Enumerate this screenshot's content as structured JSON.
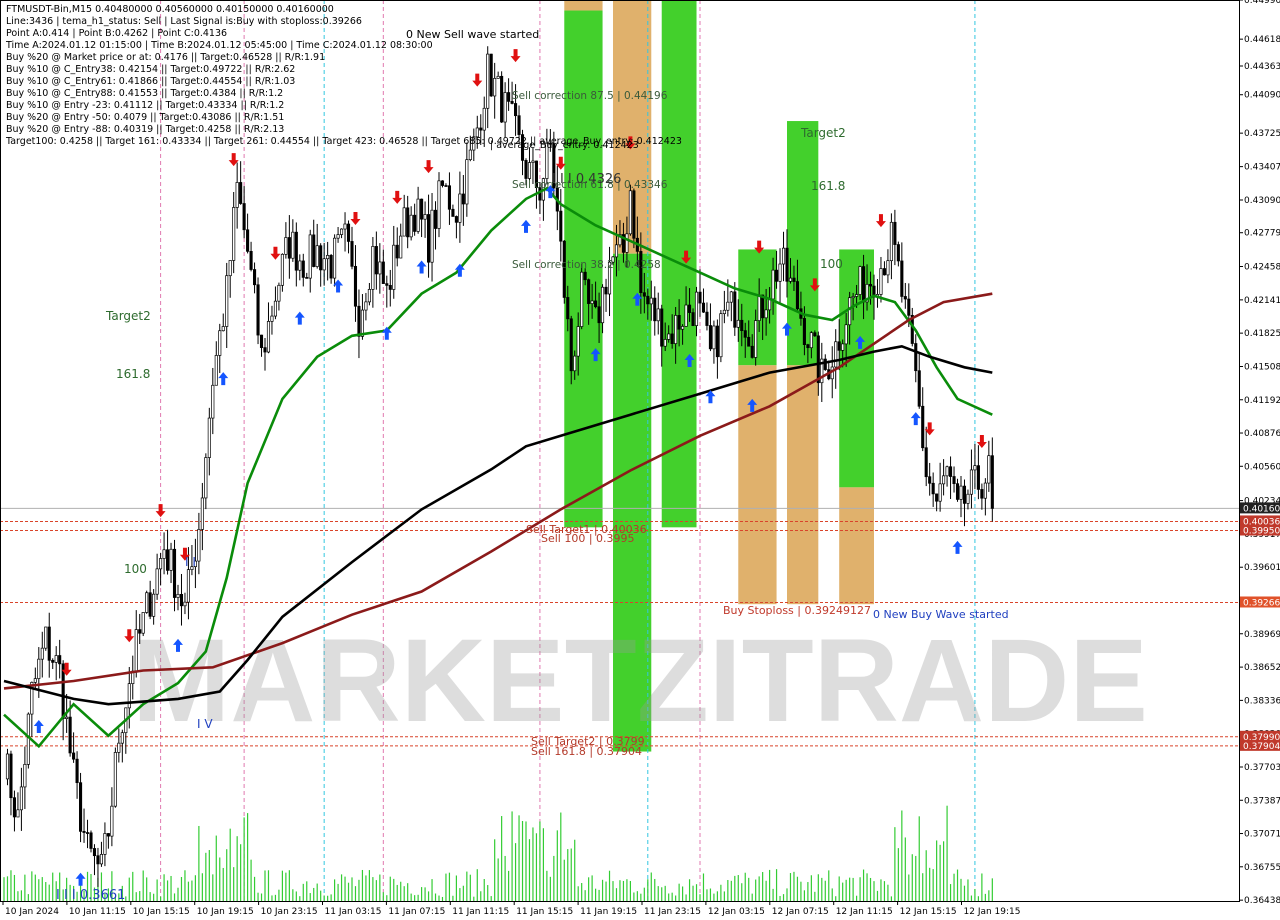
{
  "header": {
    "symbol_line": "FTMUSDT-Bin,M15  0.40480000 0.40560000 0.40150000 0.40160000",
    "info_lines": [
      "Line:3436 | tema_h1_status: Sell | Last Signal is:Buy with stoploss:0.39266",
      "Point A:0.414 | Point B:0.4262 | Point C:0.4136",
      "Time A:2024.01.12 01:15:00 | Time B:2024.01.12 05:45:00 | Time C:2024.01.12 08:30:00",
      "Buy %20 @ Market price or at: 0.4176 || Target:0.46528 || R/R:1.91",
      "Buy %10 @ C_Entry38: 0.42154 || Target:0.49722 || R/R:2.62",
      "Buy %10 @ C_Entry61: 0.41866 || Target:0.44554 || R/R:1.03",
      "Buy %10 @ C_Entry88: 0.41553 || Target:0.4384 || R/R:1.2",
      "Buy %10 @ Entry -23: 0.41112 || Target:0.43334 || R/R:1.2",
      "Buy %20 @ Entry -50: 0.4079 || Target:0.43086 || R/R:1.51",
      "Buy %20 @ Entry -88: 0.40319 || Target:0.4258 || R/R:2.13",
      "Target100: 0.4258 || Target 161: 0.43334 || Target 261: 0.44554 || Target 423: 0.46528 || Target 685: 0.49722 || average_Buy_entry: 0.412423"
    ]
  },
  "watermark": "MARKETZITRADE",
  "colors": {
    "green_zone": "#33cc1a",
    "orange_zone": "#d9a04c",
    "green_ma": "#0a8c0a",
    "red_ma": "#8b1a1a",
    "black_ma": "#000000",
    "candle": "#000000",
    "volume": "#33cc33",
    "buy_arrow": "#1455ff",
    "sell_arrow": "#e01010",
    "price_line": "#b0b0b0",
    "level_red": "#d9442a",
    "axis_label_bg": "#c0392b"
  },
  "annotations": {
    "sell_wave": "0 New Sell wave started",
    "buy_wave": "0 New Buy Wave started",
    "sell_correction_875": "Sell correction 87.5 | 0.44196",
    "sell_correction_618": "Sell correction 61.8 | 0.43346",
    "sell_correction_382": "Sell correction 38.2 | 0.4258",
    "avg_buy": "| average_Buy_entry: 0.412423",
    "iii_label": "I I I 0.4326",
    "target2_top": "Target2",
    "f1618_top": "161.8",
    "f100_top": "100",
    "target2_left": "Target2",
    "f1618_left": "161.8",
    "f100_left": "100",
    "sell_target1": "Sell Target1 | 0.40036",
    "sell_100": "Sell 100 | 0.3995",
    "buy_stoploss": "Buy Stoploss | 0.39249127",
    "sell_target2": "Sell Target2 | 0.3799",
    "sell_1618": "Sell 161.8 | 0.37904",
    "bottom_label": "I I I 0.3661",
    "iv_label": "I V",
    "ii_label": "I I"
  },
  "chart_data": {
    "type": "candlestick",
    "symbol": "FTMUSDT-Bin",
    "timeframe": "M15",
    "ohlc_last": {
      "open": 0.4048,
      "high": 0.4056,
      "low": 0.4015,
      "close": 0.4016
    },
    "ylim": [
      0.3643,
      0.4499
    ],
    "y_ticks": [
      "0.44990",
      "0.44618",
      "0.44363",
      "0.44090",
      "0.43725",
      "0.43407",
      "0.43090",
      "0.42779",
      "0.42458",
      "0.42141",
      "0.41825",
      "0.41508",
      "0.41192",
      "0.40876",
      "0.40560",
      "0.40234",
      "0.39917",
      "0.39601",
      "0.39285",
      "0.38969",
      "0.38652",
      "0.38336",
      "0.38020",
      "0.37703",
      "0.37387",
      "0.37071",
      "0.36755",
      "0.36438"
    ],
    "x_ticks": [
      "10 Jan 2024",
      "10 Jan 11:15",
      "10 Jan 15:15",
      "10 Jan 19:15",
      "10 Jan 23:15",
      "11 Jan 03:15",
      "11 Jan 07:15",
      "11 Jan 11:15",
      "11 Jan 15:15",
      "11 Jan 19:15",
      "11 Jan 23:15",
      "12 Jan 03:15",
      "12 Jan 07:15",
      "12 Jan 11:15",
      "12 Jan 15:15",
      "12 Jan 19:15"
    ],
    "price_labels": [
      {
        "value": 0.4016,
        "text": "0.40160",
        "style": "dark"
      },
      {
        "value": 0.40036,
        "text": "0.40036",
        "style": "red"
      },
      {
        "value": 0.3995,
        "text": "0.39950",
        "style": "red"
      },
      {
        "value": 0.39266,
        "text": "0.39266",
        "style": "orange"
      },
      {
        "value": 0.3799,
        "text": "0.37990",
        "style": "red"
      },
      {
        "value": 0.37904,
        "text": "0.37904",
        "style": "red"
      }
    ],
    "levels": [
      {
        "name": "current",
        "value": 0.4016,
        "style": "gray"
      },
      {
        "name": "sell_target1",
        "value": 0.40036,
        "style": "red-dash"
      },
      {
        "name": "sell_100",
        "value": 0.3995,
        "style": "red-dash"
      },
      {
        "name": "buy_stoploss",
        "value": 0.39266,
        "style": "red-dash"
      },
      {
        "name": "sell_target2",
        "value": 0.3799,
        "style": "red-dash"
      },
      {
        "name": "sell_1618",
        "value": 0.37904,
        "style": "red-dash"
      }
    ],
    "zones": [
      {
        "color": "orange",
        "i0": 161,
        "i1": 172,
        "top": 0.4499,
        "bottom": 0.4489
      },
      {
        "color": "green",
        "i0": 161,
        "i1": 172,
        "top": 0.4489,
        "bottom": 0.3998
      },
      {
        "color": "orange",
        "i0": 175,
        "i1": 186,
        "top": 0.4499,
        "bottom": 0.4258
      },
      {
        "color": "green",
        "i0": 175,
        "i1": 186,
        "top": 0.4258,
        "bottom": 0.3785
      },
      {
        "color": "green",
        "i0": 189,
        "i1": 199,
        "top": 0.4499,
        "bottom": 0.3998
      },
      {
        "color": "green",
        "i0": 211,
        "i1": 222,
        "top": 0.4262,
        "bottom": 0.4152
      },
      {
        "color": "orange",
        "i0": 211,
        "i1": 222,
        "top": 0.4152,
        "bottom": 0.3925
      },
      {
        "color": "green",
        "i0": 225,
        "i1": 234,
        "top": 0.4384,
        "bottom": 0.4152
      },
      {
        "color": "orange",
        "i0": 225,
        "i1": 234,
        "top": 0.4152,
        "bottom": 0.3925
      },
      {
        "color": "green",
        "i0": 240,
        "i1": 250,
        "top": 0.4262,
        "bottom": 0.4036
      },
      {
        "color": "orange",
        "i0": 240,
        "i1": 250,
        "top": 0.4036,
        "bottom": 0.3925
      }
    ],
    "cyan_vlines": [
      92,
      185,
      279
    ],
    "pink_vlines": [
      45,
      69,
      109,
      154,
      200
    ],
    "anchors": [
      [
        0,
        0.378
      ],
      [
        4,
        0.372
      ],
      [
        8,
        0.384
      ],
      [
        12,
        0.389
      ],
      [
        16,
        0.386
      ],
      [
        20,
        0.376
      ],
      [
        24,
        0.369
      ],
      [
        28,
        0.367
      ],
      [
        30,
        0.371
      ],
      [
        33,
        0.38
      ],
      [
        37,
        0.387
      ],
      [
        41,
        0.392
      ],
      [
        46,
        0.398
      ],
      [
        48,
        0.396
      ],
      [
        52,
        0.392
      ],
      [
        56,
        0.4
      ],
      [
        60,
        0.414
      ],
      [
        64,
        0.422
      ],
      [
        67,
        0.432
      ],
      [
        70,
        0.426
      ],
      [
        74,
        0.416
      ],
      [
        78,
        0.422
      ],
      [
        82,
        0.427
      ],
      [
        86,
        0.425
      ],
      [
        90,
        0.426
      ],
      [
        94,
        0.425
      ],
      [
        98,
        0.427
      ],
      [
        102,
        0.42
      ],
      [
        106,
        0.426
      ],
      [
        110,
        0.422
      ],
      [
        114,
        0.428
      ],
      [
        118,
        0.43
      ],
      [
        122,
        0.427
      ],
      [
        126,
        0.432
      ],
      [
        130,
        0.43
      ],
      [
        135,
        0.436
      ],
      [
        139,
        0.443
      ],
      [
        142,
        0.441
      ],
      [
        146,
        0.438
      ],
      [
        150,
        0.434
      ],
      [
        154,
        0.432
      ],
      [
        157,
        0.436
      ],
      [
        160,
        0.426
      ],
      [
        163,
        0.415
      ],
      [
        166,
        0.422
      ],
      [
        170,
        0.419
      ],
      [
        174,
        0.425
      ],
      [
        178,
        0.426
      ],
      [
        180,
        0.432
      ],
      [
        183,
        0.422
      ],
      [
        187,
        0.42
      ],
      [
        191,
        0.418
      ],
      [
        195,
        0.42
      ],
      [
        199,
        0.421
      ],
      [
        203,
        0.416
      ],
      [
        207,
        0.42
      ],
      [
        211,
        0.421
      ],
      [
        215,
        0.418
      ],
      [
        219,
        0.422
      ],
      [
        223,
        0.425
      ],
      [
        227,
        0.422
      ],
      [
        231,
        0.418
      ],
      [
        235,
        0.414
      ],
      [
        239,
        0.417
      ],
      [
        243,
        0.421
      ],
      [
        247,
        0.423
      ],
      [
        251,
        0.424
      ],
      [
        255,
        0.427
      ],
      [
        257,
        0.424
      ],
      [
        259,
        0.42
      ],
      [
        262,
        0.414
      ],
      [
        265,
        0.405
      ],
      [
        268,
        0.402
      ],
      [
        271,
        0.405
      ],
      [
        274,
        0.401
      ],
      [
        277,
        0.403
      ],
      [
        280,
        0.404
      ],
      [
        283,
        0.405
      ],
      [
        284,
        0.4016
      ]
    ],
    "series": [
      {
        "name": "",
        "color": "green",
        "points": [
          [
            0,
            0.382
          ],
          [
            10,
            0.379
          ],
          [
            20,
            0.383
          ],
          [
            30,
            0.38
          ],
          [
            40,
            0.383
          ],
          [
            50,
            0.385
          ],
          [
            58,
            0.388
          ],
          [
            64,
            0.395
          ],
          [
            70,
            0.404
          ],
          [
            80,
            0.412
          ],
          [
            90,
            0.416
          ],
          [
            100,
            0.418
          ],
          [
            110,
            0.4185
          ],
          [
            120,
            0.422
          ],
          [
            130,
            0.424
          ],
          [
            140,
            0.428
          ],
          [
            150,
            0.431
          ],
          [
            156,
            0.432
          ],
          [
            160,
            0.4305
          ],
          [
            170,
            0.4285
          ],
          [
            180,
            0.427
          ],
          [
            190,
            0.4255
          ],
          [
            200,
            0.424
          ],
          [
            210,
            0.4225
          ],
          [
            220,
            0.4215
          ],
          [
            230,
            0.42
          ],
          [
            238,
            0.4195
          ],
          [
            244,
            0.4208
          ],
          [
            250,
            0.4218
          ],
          [
            256,
            0.4212
          ],
          [
            262,
            0.4185
          ],
          [
            268,
            0.415
          ],
          [
            274,
            0.412
          ],
          [
            284,
            0.4105
          ]
        ]
      },
      {
        "name": "",
        "color": "red",
        "points": [
          [
            0,
            0.3845
          ],
          [
            20,
            0.3852
          ],
          [
            40,
            0.3862
          ],
          [
            60,
            0.3865
          ],
          [
            80,
            0.3888
          ],
          [
            100,
            0.3915
          ],
          [
            120,
            0.3937
          ],
          [
            140,
            0.3975
          ],
          [
            160,
            0.4015
          ],
          [
            180,
            0.4052
          ],
          [
            200,
            0.4085
          ],
          [
            220,
            0.4113
          ],
          [
            240,
            0.415
          ],
          [
            260,
            0.4195
          ],
          [
            270,
            0.4212
          ],
          [
            284,
            0.422
          ]
        ]
      },
      {
        "name": "",
        "color": "black",
        "points": [
          [
            0,
            0.3852
          ],
          [
            20,
            0.3835
          ],
          [
            30,
            0.383
          ],
          [
            50,
            0.3835
          ],
          [
            62,
            0.3842
          ],
          [
            70,
            0.3872
          ],
          [
            80,
            0.3913
          ],
          [
            100,
            0.3965
          ],
          [
            120,
            0.4015
          ],
          [
            140,
            0.4053
          ],
          [
            150,
            0.4075
          ],
          [
            160,
            0.4085
          ],
          [
            180,
            0.4105
          ],
          [
            200,
            0.4125
          ],
          [
            220,
            0.4145
          ],
          [
            240,
            0.4157
          ],
          [
            250,
            0.4165
          ],
          [
            258,
            0.417
          ],
          [
            266,
            0.416
          ],
          [
            276,
            0.415
          ],
          [
            284,
            0.4145
          ]
        ]
      }
    ]
  }
}
